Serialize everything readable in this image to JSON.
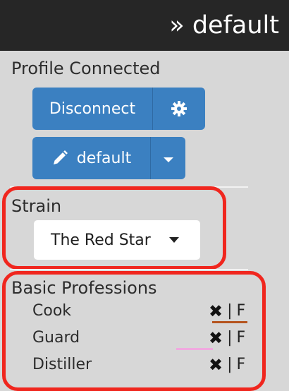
{
  "header": {
    "title": "» default"
  },
  "profile": {
    "heading": "Profile Connected",
    "disconnect_label": "Disconnect",
    "settings_icon": "gear-icon",
    "profile_name": "default",
    "edit_icon": "pencil-icon",
    "dropdown_icon": "caret-down-icon"
  },
  "strain": {
    "heading": "Strain",
    "selected": "The Red Star"
  },
  "professions": {
    "heading": "Basic Professions",
    "remove_symbol": "✖",
    "separator": "|",
    "flag_label": "F",
    "items": [
      {
        "name": "Cook",
        "color": "#b5541e"
      },
      {
        "name": "Guard",
        "color": "#f0a9df"
      },
      {
        "name": "Distiller",
        "color": ""
      }
    ]
  },
  "colors": {
    "topbar": "#262626",
    "button": "#3b80c1",
    "highlight": "#f0261e",
    "background": "#d7d7d7"
  }
}
